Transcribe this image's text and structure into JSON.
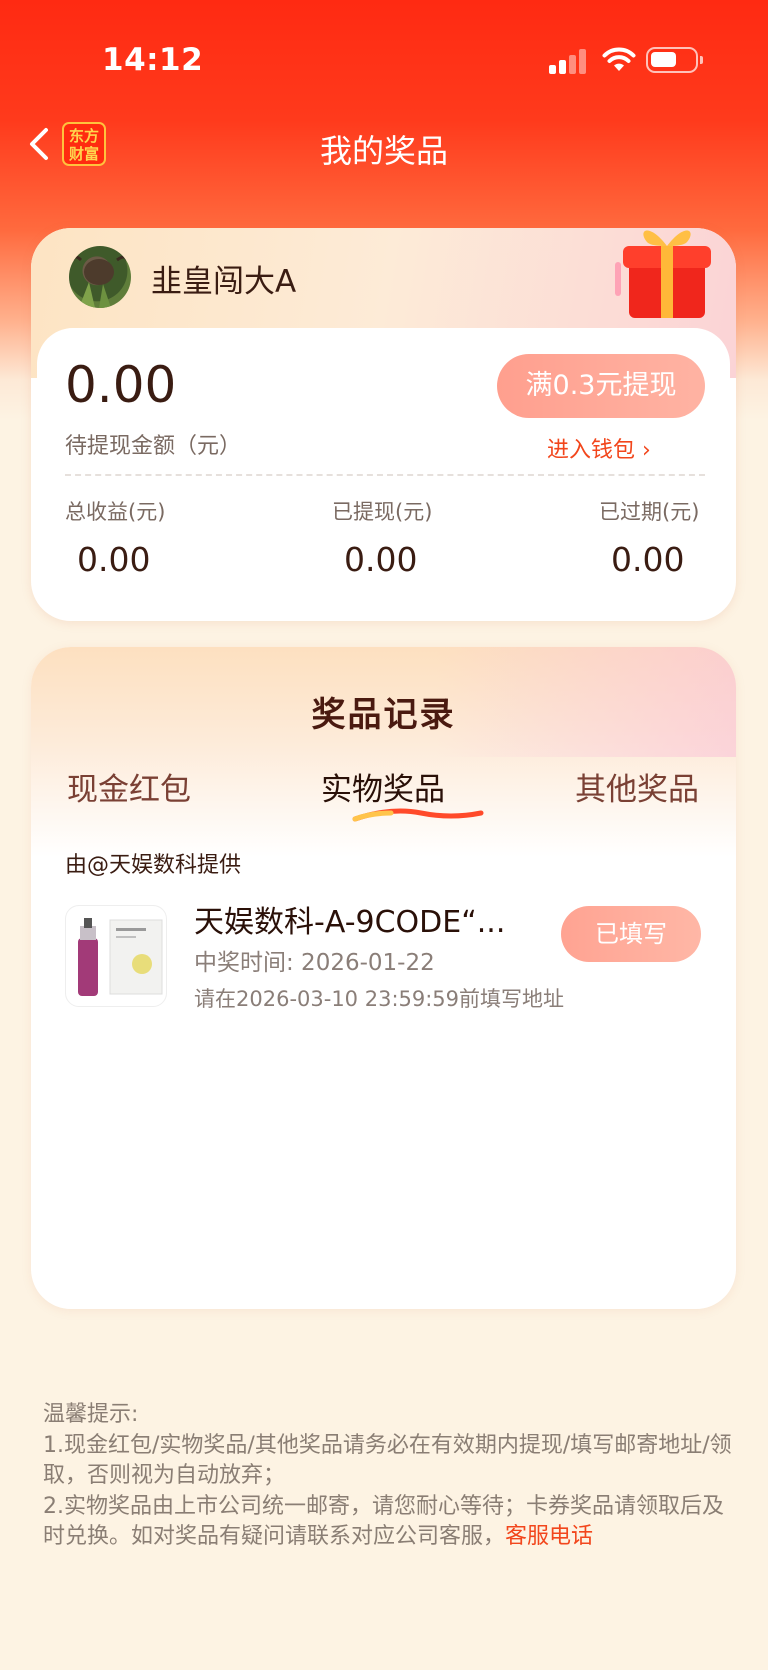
{
  "status_bar": {
    "time": "14:12"
  },
  "nav": {
    "title": "我的奖品",
    "logo_line1": "东方",
    "logo_line2": "财富"
  },
  "user": {
    "name": "韭皇闯大A"
  },
  "balance": {
    "amount": "0.00",
    "label": "待提现金额（元）",
    "withdraw_button": "满0.3元提现",
    "wallet_link": "进入钱包",
    "stats": [
      {
        "label": "总收益(元)",
        "value": "0.00"
      },
      {
        "label": "已提现(元)",
        "value": "0.00"
      },
      {
        "label": "已过期(元)",
        "value": "0.00"
      }
    ]
  },
  "records": {
    "title": "奖品记录",
    "tabs": [
      {
        "label": "现金红包",
        "active": false
      },
      {
        "label": "实物奖品",
        "active": true
      },
      {
        "label": "其他奖品",
        "active": false
      }
    ],
    "source": "由@天娱数科提供",
    "items": [
      {
        "name": "天娱数科-A-9CODE“...",
        "win_time": "中奖时间: 2026-01-22",
        "deadline": "请在2026-03-10 23:59:59前填写地址",
        "status_button": "已填写"
      }
    ]
  },
  "tips": {
    "heading": "温馨提示:",
    "line1": "1.现金红包/实物奖品/其他奖品请务必在有效期内提现/填写邮寄地址/领取，否则视为自动放弃；",
    "line2": "2.实物奖品由上市公司统一邮寄，请您耐心等待；卡券奖品请领取后及时兑换。如对奖品有疑问请联系对应公司客服，",
    "link": "客服电话"
  },
  "colors": {
    "brand_red": "#ff2a12",
    "accent_orange": "#f2461c",
    "button_pink": "#ffa392",
    "page_bg": "#fdf3e3"
  },
  "icons": [
    "back-arrow-icon",
    "signal-icon",
    "wifi-icon",
    "battery-icon",
    "gift-box-icon",
    "chevron-right-icon"
  ]
}
